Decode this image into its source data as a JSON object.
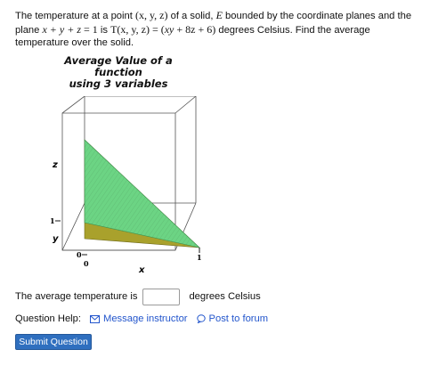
{
  "problem": {
    "p1": "The temperature at a point ",
    "point": "(x, y, z)",
    "p2": " of a solid, ",
    "solid": "E",
    "p3": " bounded by the coordinate planes and the plane ",
    "plane_lhs": "x + y + z",
    "plane_eq": " = 1",
    "p4": " is ",
    "temp_func": "T(x, y, z)",
    "temp_eq": " = (",
    "temp_expr": "xy",
    "temp_rest": " + 8z + 6)",
    "p5": " degrees Celsius. Find the average temperature over the solid."
  },
  "figure": {
    "title_line1": "Average Value of a function",
    "title_line2": "using 3 variables",
    "axis_z": "z",
    "axis_y": "y",
    "axis_x": "x",
    "tick_z1": "1",
    "tick_y0": "0",
    "tick_x0": "0",
    "tick_x1": "1",
    "colors": {
      "face_green": "#6cd484",
      "face_olive": "#a9a12c",
      "hatch": "#4f9f5f",
      "box_line": "#555555"
    }
  },
  "answer": {
    "prefix": "The average temperature is",
    "suffix": "degrees Celsius",
    "value": ""
  },
  "help": {
    "label": "Question Help:",
    "message": "Message instructor",
    "forum": "Post to forum"
  },
  "submit_label": "Submit Question"
}
